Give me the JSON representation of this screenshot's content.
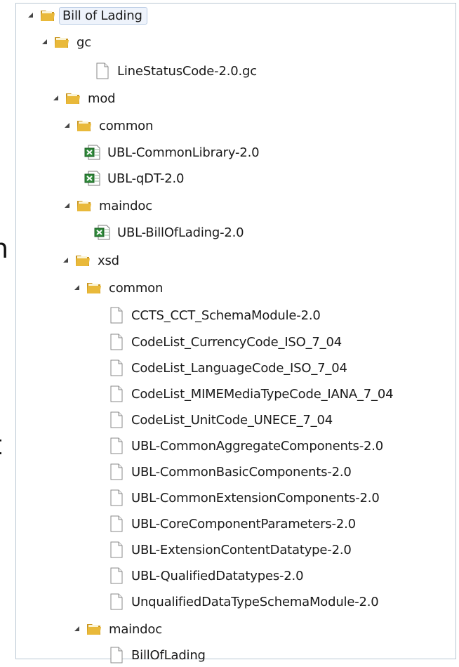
{
  "tree": [
    {
      "label": "Bill of Lading",
      "kind": "folder",
      "depth": 0,
      "expanded": true,
      "selected": true
    },
    {
      "label": "gc",
      "kind": "folder",
      "depth": 1,
      "expanded": true
    },
    {
      "label": "LineStatusCode-2.0.gc",
      "kind": "file",
      "depth": 3
    },
    {
      "label": "mod",
      "kind": "folder",
      "depth": 1,
      "expanded": true
    },
    {
      "label": "common",
      "kind": "folder",
      "depth": 2,
      "expanded": true
    },
    {
      "label": "UBL-CommonLibrary-2.0",
      "kind": "spreadsheet",
      "depth": 3
    },
    {
      "label": "UBL-qDT-2.0",
      "kind": "spreadsheet",
      "depth": 3
    },
    {
      "label": "maindoc",
      "kind": "folder",
      "depth": 2,
      "expanded": true
    },
    {
      "label": "UBL-BillOfLading-2.0",
      "kind": "spreadsheet",
      "depth": 4
    },
    {
      "label": "xsd",
      "kind": "folder",
      "depth": 1,
      "expanded": true
    },
    {
      "label": "common",
      "kind": "folder",
      "depth": 2,
      "expanded": true
    },
    {
      "label": "CCTS_CCT_SchemaModule-2.0",
      "kind": "file",
      "depth": 4
    },
    {
      "label": "CodeList_CurrencyCode_ISO_7_04",
      "kind": "file",
      "depth": 4
    },
    {
      "label": "CodeList_LanguageCode_ISO_7_04",
      "kind": "file",
      "depth": 4
    },
    {
      "label": "CodeList_MIMEMediaTypeCode_IANA_7_04",
      "kind": "file",
      "depth": 4
    },
    {
      "label": "CodeList_UnitCode_UNECE_7_04",
      "kind": "file",
      "depth": 4
    },
    {
      "label": "UBL-CommonAggregateComponents-2.0",
      "kind": "file",
      "depth": 4
    },
    {
      "label": "UBL-CommonBasicComponents-2.0",
      "kind": "file",
      "depth": 4
    },
    {
      "label": "UBL-CommonExtensionComponents-2.0",
      "kind": "file",
      "depth": 4
    },
    {
      "label": "UBL-CoreComponentParameters-2.0",
      "kind": "file",
      "depth": 4
    },
    {
      "label": "UBL-ExtensionContentDatatype-2.0",
      "kind": "file",
      "depth": 4
    },
    {
      "label": "UBL-QualifiedDatatypes-2.0",
      "kind": "file",
      "depth": 4
    },
    {
      "label": "UnqualifiedDataTypeSchemaModule-2.0",
      "kind": "file",
      "depth": 4
    },
    {
      "label": "maindoc",
      "kind": "folder",
      "depth": 2,
      "expanded": true
    },
    {
      "label": "BillOfLading",
      "kind": "file",
      "depth": 4
    }
  ],
  "edge_fragments": [
    "n",
    "l",
    "t",
    "."
  ],
  "colors": {
    "folder": "#e9b93a",
    "spreadsheet": "#2f8a3a",
    "border": "#b9c6d3"
  }
}
